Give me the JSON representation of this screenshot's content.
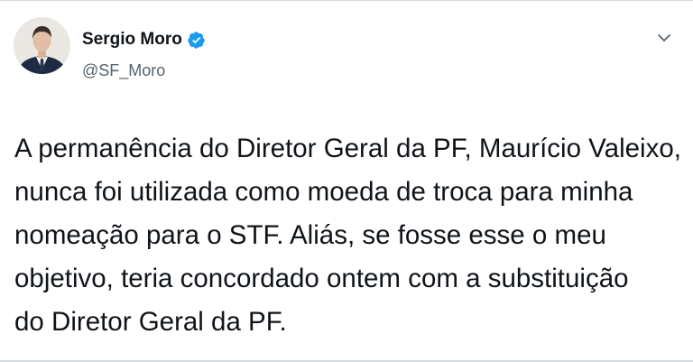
{
  "author": {
    "display_name": "Sergio Moro",
    "handle": "@SF_Moro",
    "verified": true,
    "verified_icon": "verified-badge-icon",
    "verified_color": "#1d9bf0"
  },
  "menu_icon": "chevron-down-icon",
  "tweet": {
    "lines": [
      "A permanência do Diretor Geral da PF, Maurício Valeixo,",
      "nunca foi utilizada como moeda de troca para minha",
      "nomeação para o STF. Aliás, se fosse esse o meu",
      "objetivo, teria concordado ontem com a substituição",
      "do Diretor Geral da PF."
    ]
  },
  "colors": {
    "text": "#0f1419",
    "secondary_text": "#536471",
    "border": "#cfd9de",
    "background": "#ffffff"
  }
}
